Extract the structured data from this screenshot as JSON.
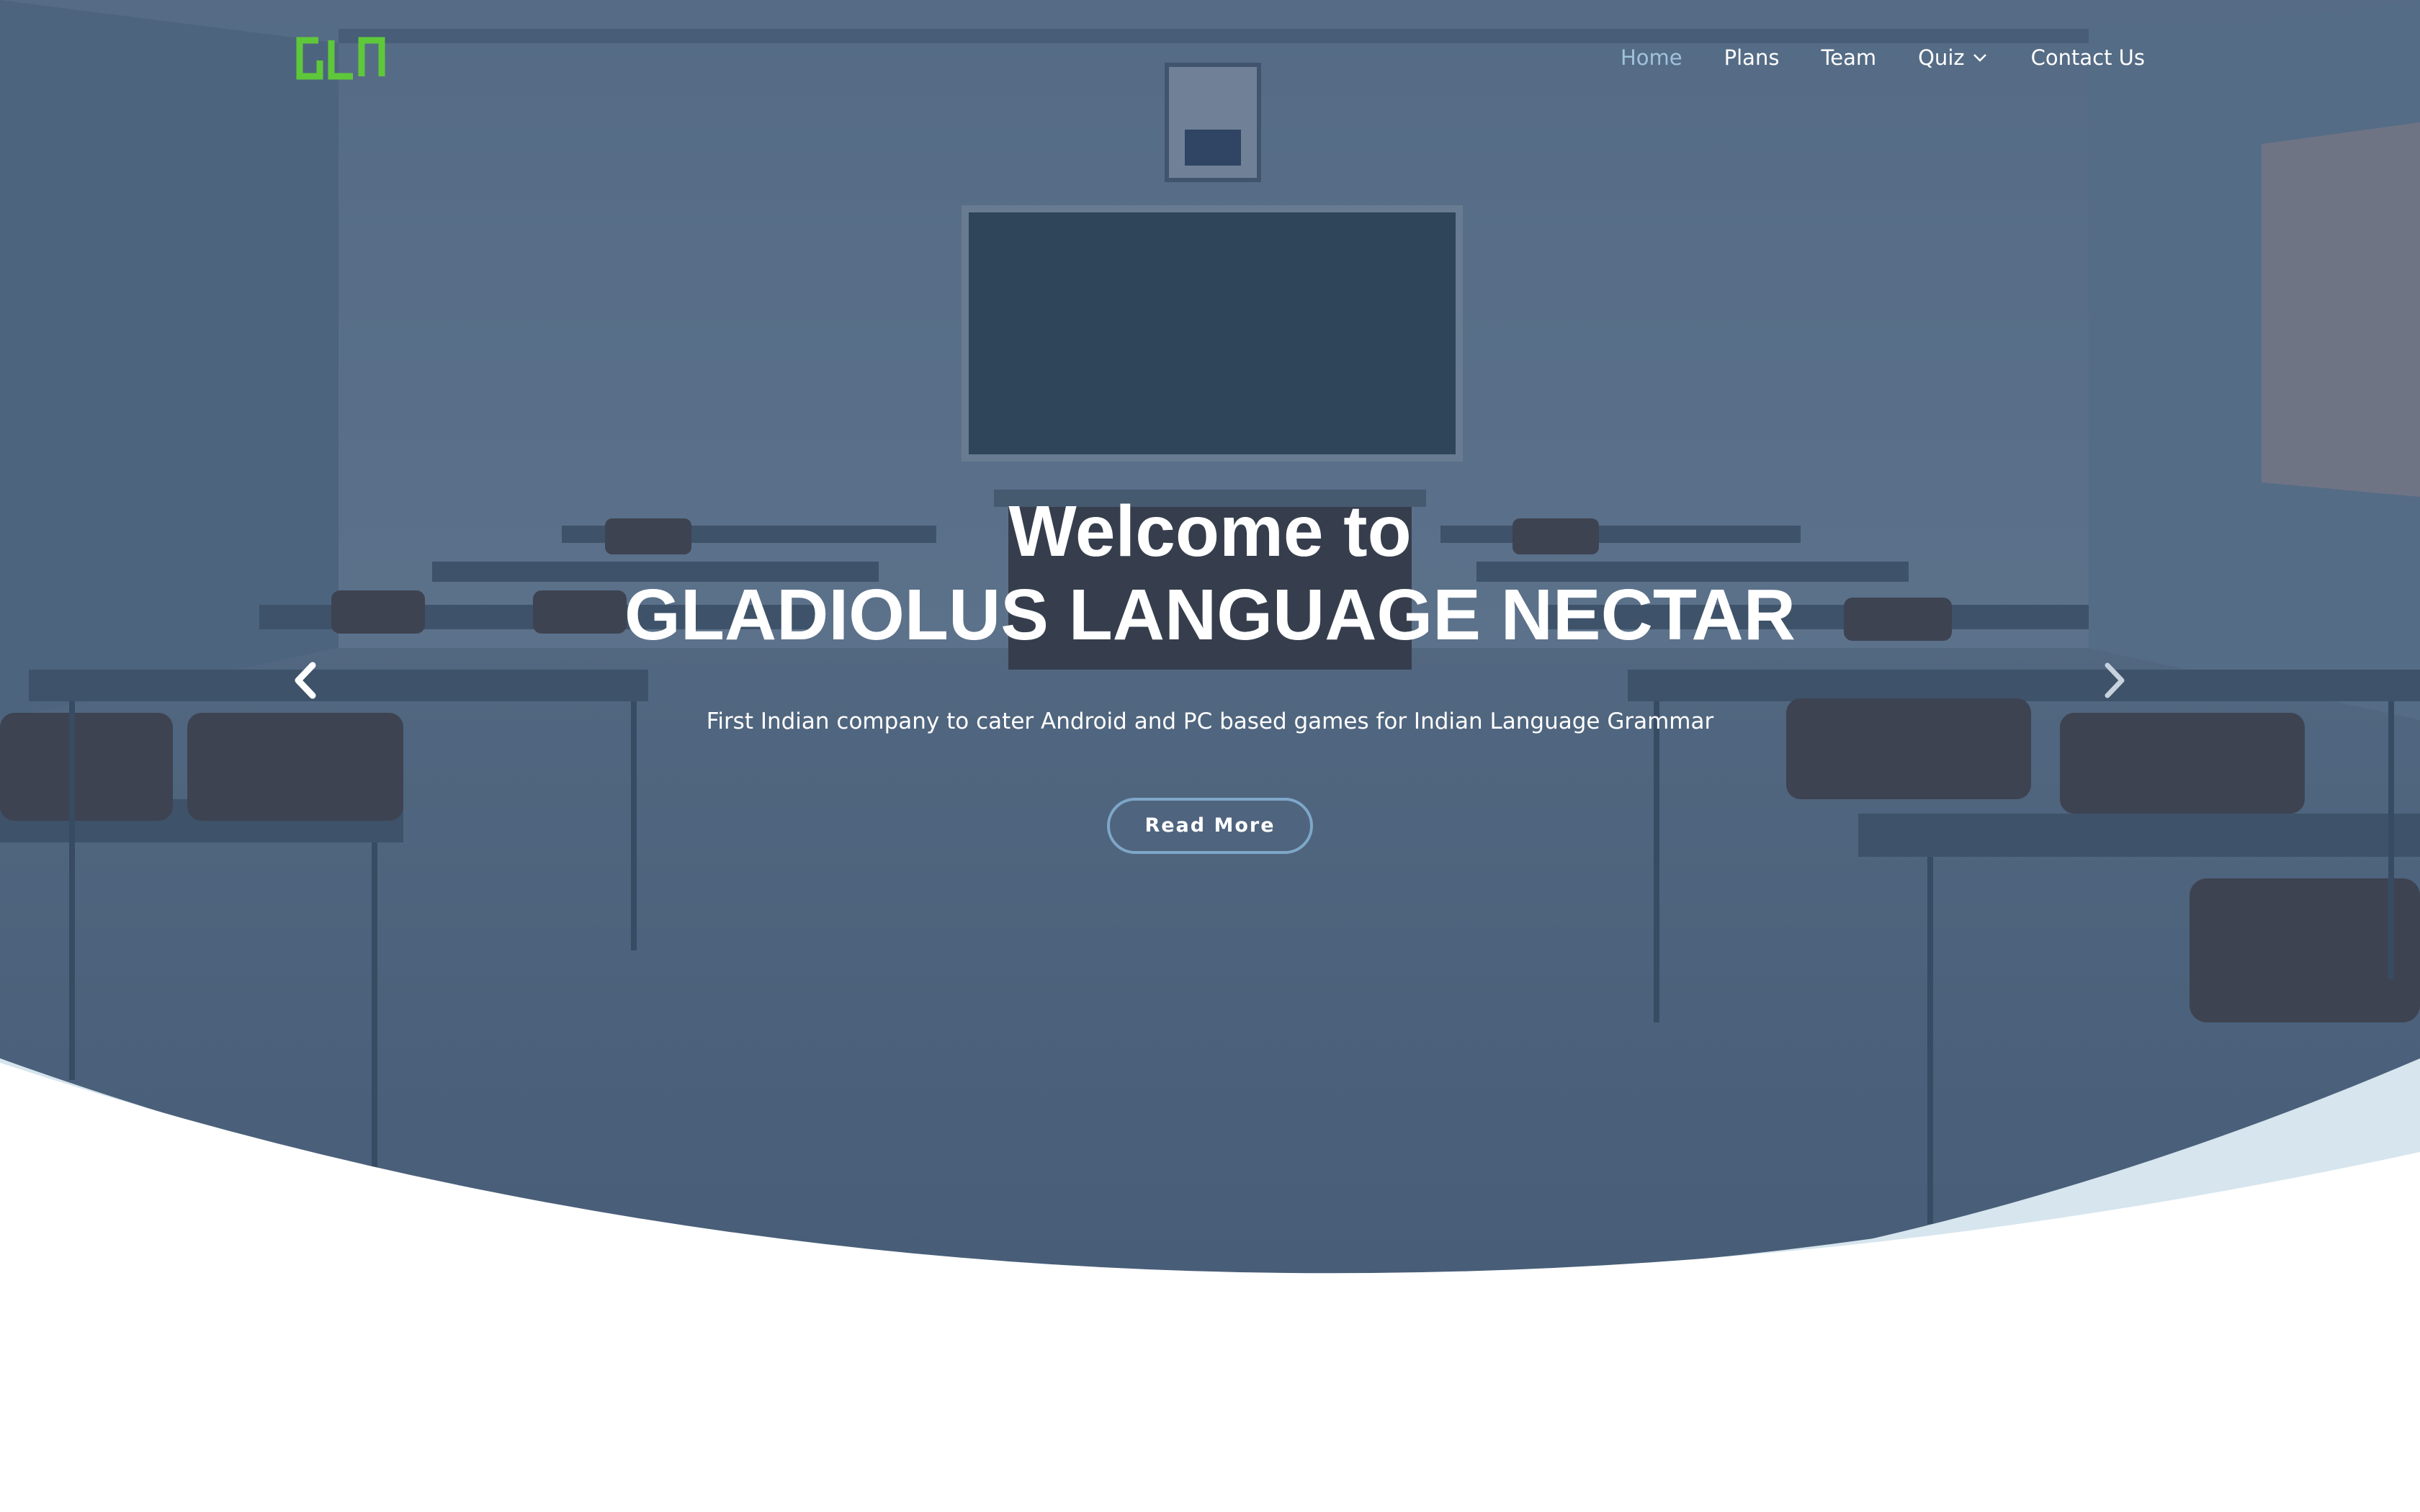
{
  "header": {
    "logo_text": "GLN",
    "nav": [
      {
        "label": "Home",
        "active": true
      },
      {
        "label": "Plans",
        "active": false
      },
      {
        "label": "Team",
        "active": false
      },
      {
        "label": "Quiz",
        "active": false,
        "has_dropdown": true
      },
      {
        "label": "Contact Us",
        "active": false
      }
    ]
  },
  "hero": {
    "title_line1": "Welcome to",
    "title_line2": "GLADIOLUS LANGUAGE NECTAR",
    "subtitle": "First Indian company to cater Android and PC based games for Indian Language Grammar",
    "button_label": "Read More",
    "prev_icon": "chevron-left-icon",
    "next_icon": "chevron-right-icon"
  },
  "colors": {
    "logo_green": "#5fc83a",
    "nav_active": "#9fc2dc",
    "overlay": "#263e5c",
    "button_border": "#7ea7c9",
    "curve_accent": "#d6e5ee"
  }
}
